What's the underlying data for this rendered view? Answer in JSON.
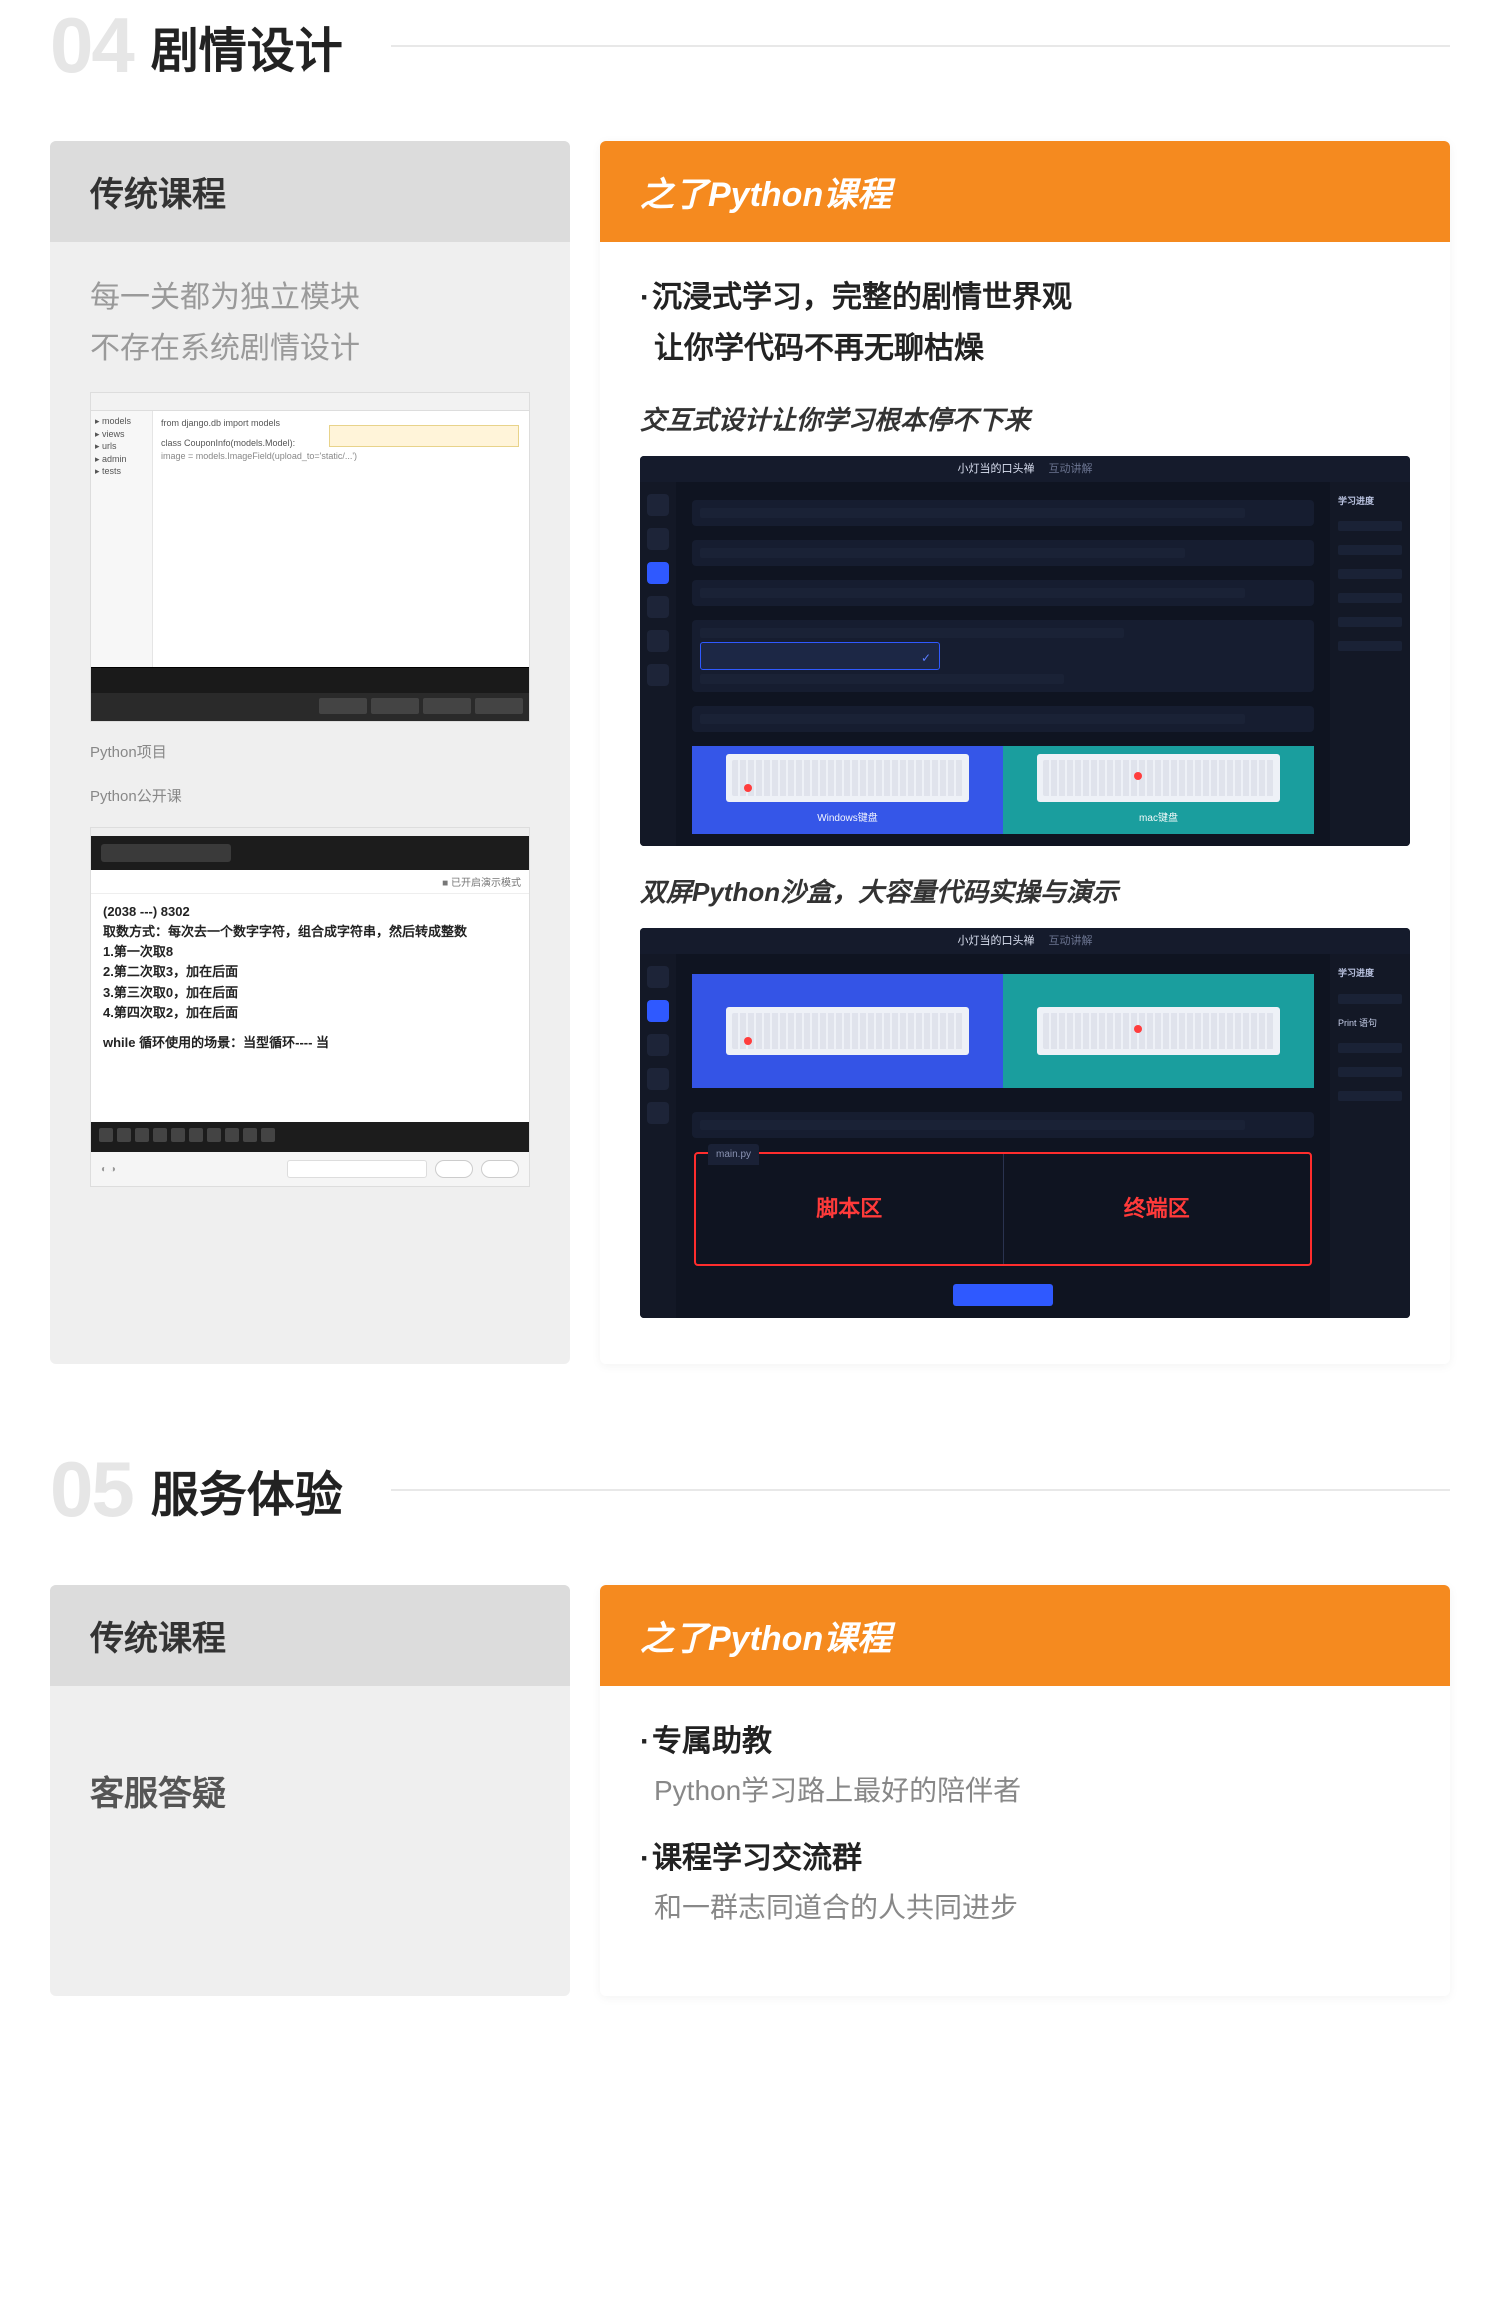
{
  "section4": {
    "num": "04",
    "title": "剧情设计",
    "left": {
      "header": "传统课程",
      "desc_l1": "每一关都为独立模块",
      "desc_l2": "不存在系统剧情设计",
      "ide_label": "Python项目",
      "ide_code1": "from django.db import models",
      "ide_code2": "class CouponInfo(models.Model):",
      "ide_code3": "    image = models.ImageField(upload_to='static/...')",
      "vid_label": "Python公开课",
      "vid_body_1": "(2038 ---) 8302",
      "vid_body_2": "取数方式：每次去一个数字字符，组合成字符串，然后转成整数",
      "vid_body_3": "1.第一次取8",
      "vid_body_4": "2.第二次取3，加在后面",
      "vid_body_5": "3.第三次取0，加在后面",
      "vid_body_6": "4.第四次取2，加在后面",
      "vid_body_7": "while 循环使用的场景：当型循环---- 当"
    },
    "right": {
      "header": "之了Python课程",
      "bullet1_l1": "沉浸式学习，完整的剧情世界观",
      "bullet1_l2": "让你学代码不再无聊枯燥",
      "caption1": "交互式设计让你学习根本停不下来",
      "caption2": "双屏Python沙盒，大容量代码实操与演示",
      "z_title": "小灯当的口头禅",
      "z_tab": "互动讲解",
      "z_side": "学习进度",
      "kb_cap1": "Windows键盘",
      "kb_cap2": "mac键盘",
      "sandbox_left": "脚本区",
      "sandbox_right": "终端区",
      "sandbox_tab": "main.py",
      "print_label": "Print 语句"
    }
  },
  "section5": {
    "num": "05",
    "title": "服务体验",
    "left": {
      "header": "传统课程",
      "body": "客服答疑"
    },
    "right": {
      "header": "之了Python课程",
      "f1_title": "专属助教",
      "f1_sub": "Python学习路上最好的陪伴者",
      "f2_title": "课程学习交流群",
      "f2_sub": "和一群志同道合的人共同进步"
    }
  }
}
